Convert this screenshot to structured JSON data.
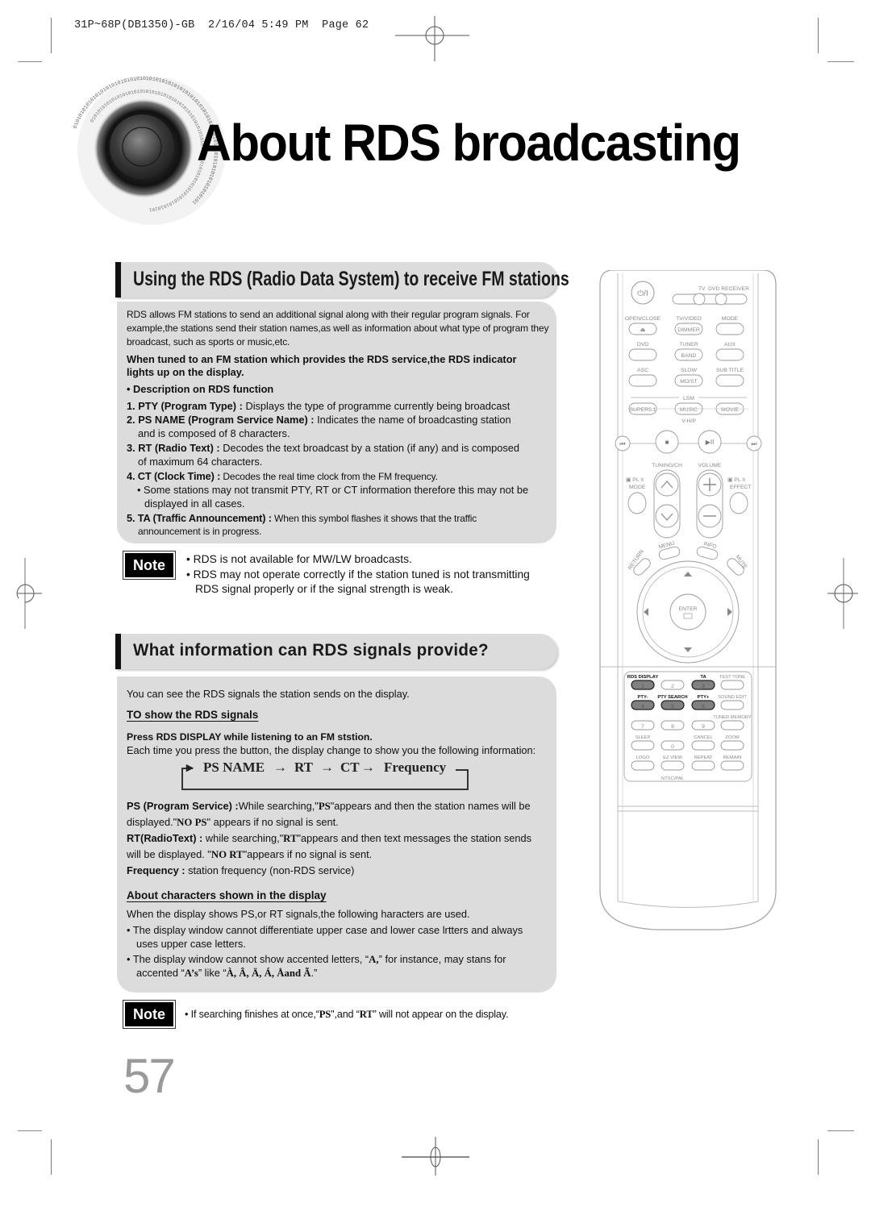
{
  "print_header": "31P~68P(DB1350)-GB  2/16/04 5:49 PM  Page 62",
  "page_title": "About RDS broadcasting",
  "page_number": "57",
  "icons": {
    "speaker": "speaker-graphic-icon",
    "binary_ring": "binary-digits-ring"
  },
  "binary_text": "0101010101010101010101010101010101010101010101010101010101010101010101010101010101",
  "section1": {
    "header": "Using the RDS (Radio Data System) to receive FM stations",
    "intro_lines": [
      "RDS allows FM stations to send an additional signal along with their regular program signals. For",
      "example,the stations send their station names,as well as information about what  type of program they",
      "broadcast, such as sports or music,etc."
    ],
    "bold_lines": [
      "When tuned to an FM station which provides the RDS service,the RDS indicator",
      "lights up on the display."
    ],
    "desc_heading": "Description on RDS function",
    "items": [
      {
        "term": "1. PTY (Program Type) :",
        "text": " Displays the type of programme currently being broadcast",
        "cont": ""
      },
      {
        "term": "2. PS NAME (Program Service Name) :",
        "text": " Indicates the name of broadcasting station",
        "cont": "and is composed of 8 characters."
      },
      {
        "term": "3. RT (Radio Text) :",
        "text": " Decodes the text broadcast by a station (if any) and is composed",
        "cont": "of maximum 64 characters."
      },
      {
        "term": "4. CT (Clock Time) :",
        "text": " Decodes the real time clock from the FM frequency.",
        "cont": ""
      },
      {
        "term": "5. TA (Traffic Announcement) :",
        "text": " When this symbol flashes it shows that the traffic",
        "cont": "announcement is in progress."
      }
    ],
    "sub_bullet": [
      "Some stations may not transmit PTY, RT or CT information therefore this may not be",
      "displayed in all cases."
    ]
  },
  "note1": {
    "badge": "Note",
    "lines": [
      "RDS is not available for MW/LW broadcasts.",
      "RDS may not operate correctly if the station tuned is not transmitting",
      "RDS signal properly or if the signal strength is weak."
    ]
  },
  "section2": {
    "header": "What information can RDS signals provide?",
    "intro": "You can see the RDS signals the station sends on the display.",
    "subheading1": "TO show the RDS signals",
    "press_line": "Press RDS DISPLAY while listening to an FM ststion.",
    "each_time": "Each time you press the button, the display change to show you the following information:",
    "flow": [
      "PS NAME",
      "RT",
      "CT",
      "Frequency"
    ],
    "ps_term": "PS (Program Service) :",
    "ps_text_a": "While searching,\"",
    "ps_code": "PS",
    "ps_text_b": "\"appears and then the station names will be",
    "ps_line2_a": "displayed.\"",
    "ps_line2_code": "NO PS",
    "ps_line2_b": "\" appears if no signal is sent.",
    "rt_term": "RT(RadioText) :",
    "rt_text_a": " while searching,\"",
    "rt_code": "RT",
    "rt_text_b": "\"appears and then text messages the station sends",
    "rt_line2_a": "will be displayed. \"",
    "rt_line2_code": "NO RT",
    "rt_line2_b": "\"appears if no signal is sent.",
    "freq_term": "Frequency :",
    "freq_text": " station frequency (non-RDS service)",
    "subheading2": "About characters shown in the display",
    "chars_intro": "When the display shows PS,or RT signals,the following haracters are used.",
    "bullet1": [
      "The display window cannot differentiate upper case and lower case lrtters and always",
      "uses upper case letters."
    ],
    "bullet2_a": "The display window  cannot show accented letters, “",
    "bullet2_code": "A,",
    "bullet2_b": "” for instance, may stans for",
    "bullet2_line2_a": "accented “",
    "bullet2_line2_code": "A’s",
    "bullet2_line2_b": "” like “",
    "bullet2_line2_letters": "À, Â, Ä, Á, Åand Ã",
    "bullet2_line2_c": ".”"
  },
  "note2": {
    "badge": "Note",
    "text_a": "If searching finishes at once,“",
    "code1": "PS",
    "text_b": "\",and “",
    "code2": "RT",
    "text_c": "” will not appear on the display."
  },
  "remote": {
    "power_label": "⏻/I",
    "mode_switch": [
      "TV",
      "DVD RECEIVER"
    ],
    "rows": [
      {
        "labels": [
          "OPEN/CLOSE",
          "TV/VIDEO",
          "MODE"
        ],
        "inner": [
          "⏏",
          "DIMMER",
          ""
        ]
      },
      {
        "labels": [
          "DVD",
          "TUNER",
          "AUX"
        ],
        "inner": [
          "",
          "BAND",
          ""
        ]
      },
      {
        "labels": [
          "ASC",
          "SLOW",
          "SUB TITLE"
        ],
        "inner": [
          "",
          "MO/ST",
          ""
        ]
      }
    ],
    "lsm_label": "LSM",
    "sound_modes": [
      "SUPER5.1",
      "MUSIC",
      "MOVIE"
    ],
    "vhp_label": "V-H/P",
    "transport": [
      "⏮",
      "■",
      "▶II",
      "⏭"
    ],
    "tuning_label": "TUNING/CH",
    "volume_label": "VOLUME",
    "pl_mode": [
      "PL II",
      "MODE"
    ],
    "pl_effect": [
      "PL II",
      "EFFECT"
    ],
    "menu_label": "MENU",
    "info_label": "INFO",
    "return_label": "RETURN",
    "mute_label": "MUTE",
    "enter_label": "ENTER",
    "keypad_rows": [
      {
        "labels": [
          "RDS DISPLAY",
          "",
          "TA",
          "TEST TONE"
        ],
        "keys": [
          "1",
          "2",
          "3",
          ""
        ],
        "dark": [
          true,
          false,
          true,
          false
        ]
      },
      {
        "labels": [
          "PTY-",
          "PTY SEARCH",
          "PTY+",
          "SOUND EDIT"
        ],
        "keys": [
          "4",
          "5",
          "6",
          ""
        ],
        "dark": [
          true,
          true,
          true,
          false
        ]
      },
      {
        "labels": [
          "",
          "",
          "",
          "TUNER MEMORY"
        ],
        "keys": [
          "7",
          "8",
          "9",
          ""
        ],
        "dark": [
          false,
          false,
          false,
          false
        ]
      },
      {
        "labels": [
          "SLEEP",
          "",
          "CANCEL",
          "ZOOM"
        ],
        "keys": [
          "",
          "0",
          "",
          ""
        ],
        "dark": [
          false,
          false,
          false,
          false
        ]
      },
      {
        "labels": [
          "LOGO",
          "EZ VIEW",
          "REPEAT",
          "REMAIN"
        ],
        "keys": [
          "",
          "",
          "",
          ""
        ],
        "dark": [
          false,
          false,
          false,
          false
        ]
      }
    ],
    "ntsc_label": "NTSC/PAL"
  },
  "colors": {
    "panel_bg": "#dcdcdc",
    "header_bar": "#111111",
    "page_number": "#9a9a9a",
    "remote_line": "#9a9a9a",
    "highlight_key": "#808080"
  }
}
